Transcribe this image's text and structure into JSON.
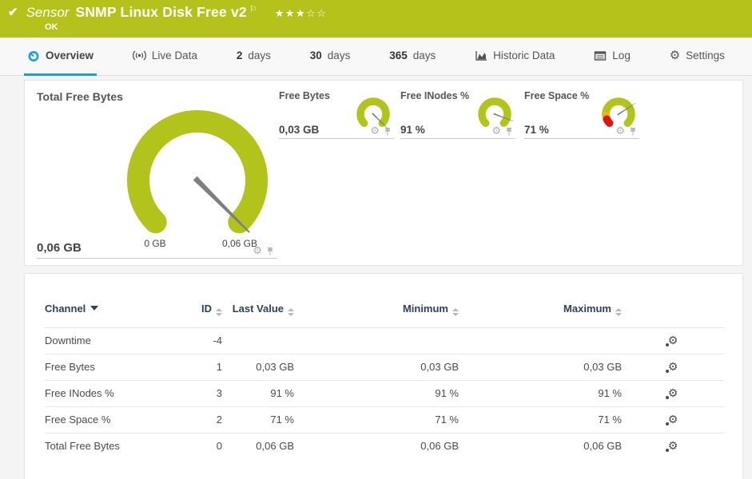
{
  "header": {
    "status_check_icon": "✔",
    "type_label": "Sensor",
    "sensor_name": "SNMP Linux Disk Free v2",
    "flag_icon": "⚐",
    "rating_stars": "★★★☆☆",
    "status": "OK"
  },
  "tabs": [
    {
      "label": "Overview",
      "active": true
    },
    {
      "label": "Live Data"
    },
    {
      "prefix": "2",
      "label": "days"
    },
    {
      "prefix": "30",
      "label": "days"
    },
    {
      "prefix": "365",
      "label": "days"
    },
    {
      "label": "Historic Data"
    },
    {
      "label": "Log"
    },
    {
      "label": "Settings"
    }
  ],
  "gauges": {
    "main": {
      "title": "Total Free Bytes",
      "value": "0,06 GB",
      "scale_min_label": "0 GB",
      "scale_max_label": "0,06 GB",
      "needle_deg": 135
    },
    "small": [
      {
        "title": "Free Bytes",
        "value": "0,03 GB",
        "needle_deg": 135
      },
      {
        "title": "Free INodes %",
        "value": "91 %",
        "needle_deg": 110.7
      },
      {
        "title": "Free Space %",
        "value": "71 %",
        "needle_deg": 56.7
      }
    ]
  },
  "table": {
    "headers": {
      "channel": "Channel",
      "id": "ID",
      "last_value": "Last Value",
      "minimum": "Minimum",
      "maximum": "Maximum"
    },
    "rows": [
      {
        "channel": "Downtime",
        "id": "-4",
        "last_value": "",
        "minimum": "",
        "maximum": ""
      },
      {
        "channel": "Free Bytes",
        "id": "1",
        "last_value": "0,03 GB",
        "minimum": "0,03 GB",
        "maximum": "0,03 GB"
      },
      {
        "channel": "Free INodes %",
        "id": "3",
        "last_value": "91 %",
        "minimum": "91 %",
        "maximum": "91 %"
      },
      {
        "channel": "Free Space %",
        "id": "2",
        "last_value": "71 %",
        "minimum": "71 %",
        "maximum": "71 %"
      },
      {
        "channel": "Total Free Bytes",
        "id": "0",
        "last_value": "0,06 GB",
        "minimum": "0,06 GB",
        "maximum": "0,06 GB"
      }
    ]
  },
  "colors": {
    "status_ok_green": "#b5c21b",
    "gauge_green": "#b2c31b",
    "active_tab_blue": "#1c9ed9",
    "gauge_warning_yellow": "#f2b600",
    "gauge_error_red": "#e01313",
    "needle_gray": "#7f7f7f"
  }
}
